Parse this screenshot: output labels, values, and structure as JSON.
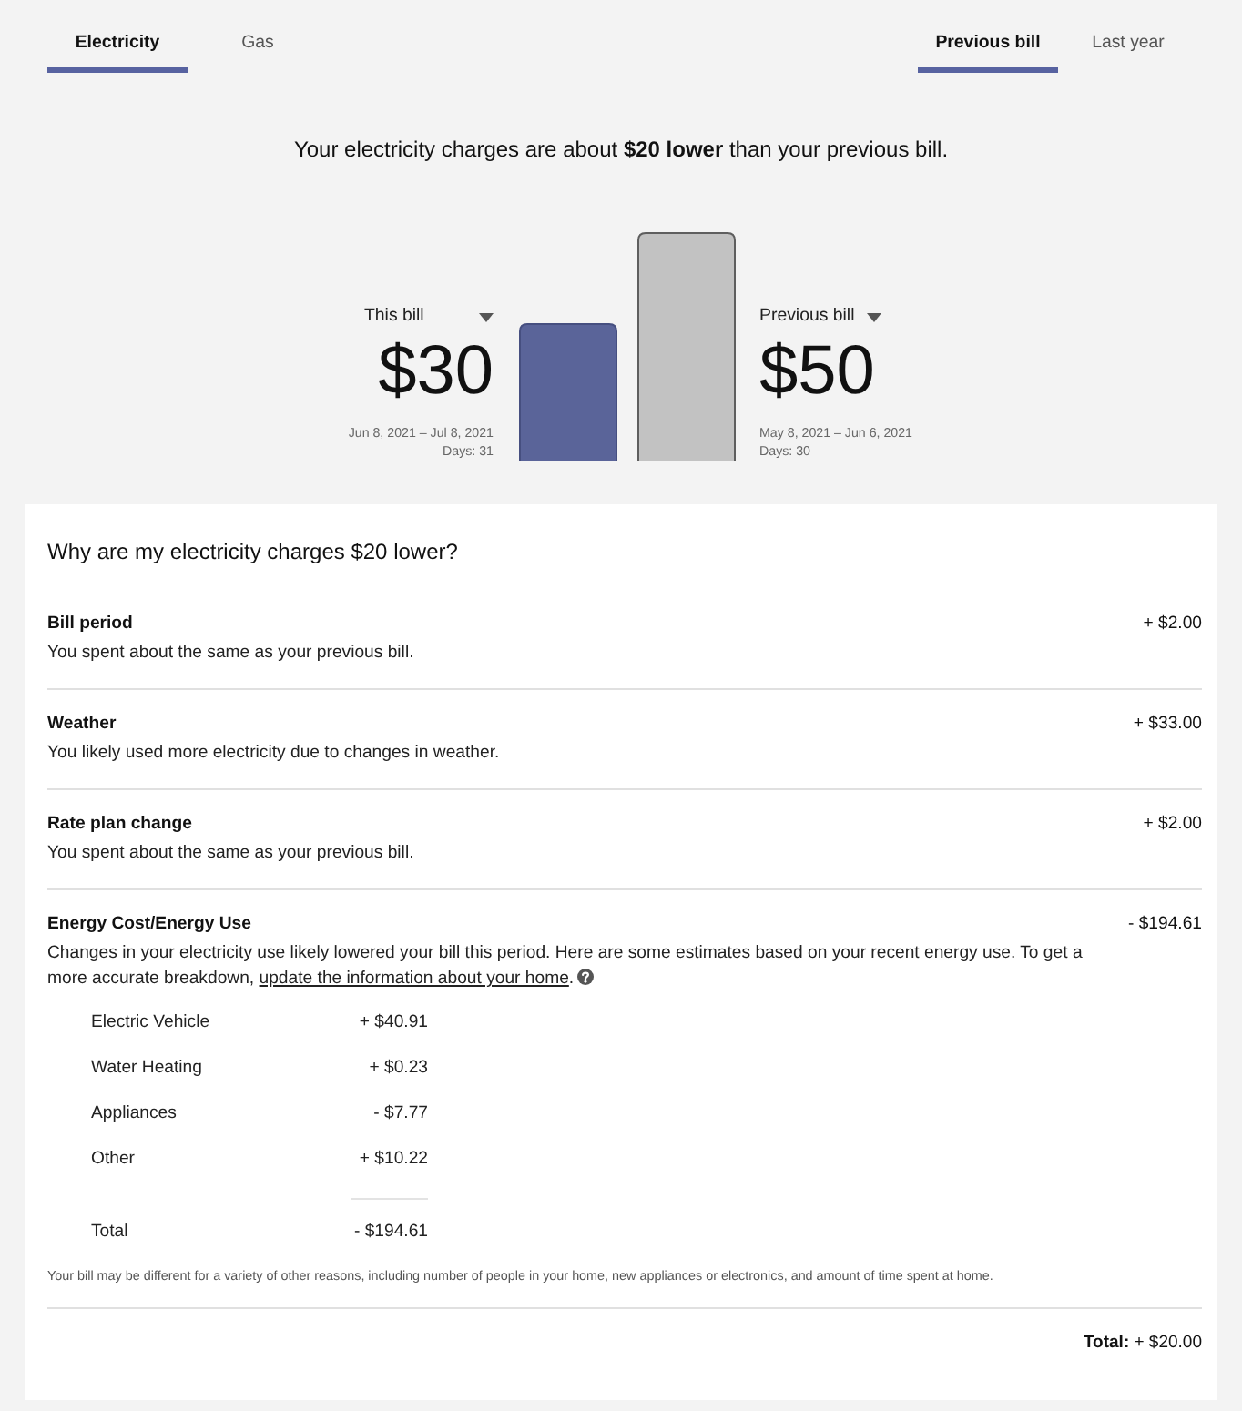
{
  "tabs_left": [
    {
      "label": "Electricity",
      "selected": true
    },
    {
      "label": "Gas",
      "selected": false
    }
  ],
  "tabs_right": [
    {
      "label": "Previous bill",
      "selected": true
    },
    {
      "label": "Last year",
      "selected": false
    }
  ],
  "headline": "Your electricity charges are about **$20 lower** than your previous bill.",
  "comparison": {
    "bills": [
      {
        "label": "This bill",
        "amount": "$30",
        "period": "Jun 8, 2021 – Jul 8, 2021",
        "days": "Days: 31"
      },
      {
        "label": "Previous bill",
        "amount": "$50",
        "period": "May 8, 2021 – Jun 6, 2021",
        "days": "Days: 30"
      }
    ]
  },
  "breakdown": {
    "title": "Why are my electricity charges $20 lower?",
    "factors": [
      {
        "kind": "simple",
        "title": "Bill period",
        "description": "You spent about the same as your previous bill.",
        "amount": "+ $2.00"
      },
      {
        "kind": "simple",
        "title": "Weather",
        "description": "You likely used more electricity due to changes in weather.",
        "amount": "+ $33.00"
      },
      {
        "kind": "simple",
        "title": "Rate plan change",
        "description": "You spent about the same as your previous bill.",
        "amount": "+ $2.00"
      },
      {
        "kind": "detailed",
        "title": "Energy Cost/Energy Use",
        "description": "Changes in your electricity use likely lowered your bill this period. Here are some estimates based on your recent energy use. To get a more accurate breakdown,",
        "link": "update the information about your home",
        "after_link": ".",
        "amount": "- $194.61",
        "items": [
          {
            "label": "Electric Vehicle",
            "amount": "+ $40.91"
          },
          {
            "label": "Water Heating",
            "amount": "+ $0.23"
          },
          {
            "label": "Appliances",
            "amount": "- $7.77"
          },
          {
            "label": "Other",
            "amount": "+ $10.22"
          }
        ],
        "total": {
          "label": "Total",
          "amount": "- $194.61"
        }
      }
    ],
    "footnote": "Your bill may be different for a variety of other reasons, including number of people in your home, new appliances or electronics, and amount of time spent at home.",
    "total": "**Total:** + $20.00"
  }
}
